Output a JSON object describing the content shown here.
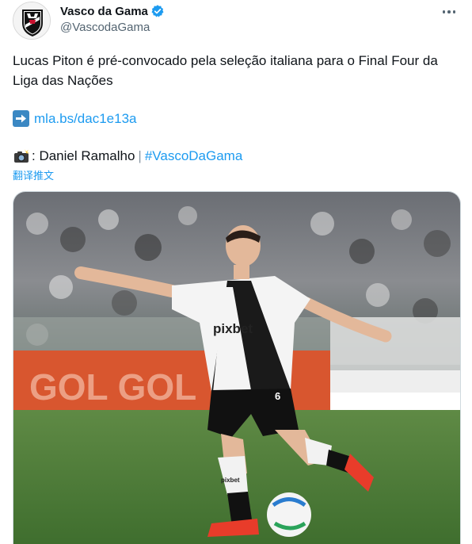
{
  "author": {
    "display_name": "Vasco da Gama",
    "handle": "@VascodaGama",
    "verified_icon": "verified-badge-icon",
    "avatar_icon": "vasco-crest-logo"
  },
  "menu": {
    "more_icon": "more-options-icon"
  },
  "tweet": {
    "text_lines": [
      "Lucas Piton é pré-convocado pela seleção italiana para o Final Four da Liga das Nações"
    ],
    "link_icon": "right-arrow-emoji-icon",
    "link_text": "mla.bs/dac1e13a",
    "credit_icon": "camera-flash-emoji-icon",
    "credit_prefix": ": Daniel Ramalho",
    "credit_separator": "|",
    "hashtag": "#VascoDaGama",
    "translate_label": "翻译推文"
  },
  "media": {
    "description": "photo",
    "jersey_sponsor": "pixbet",
    "jersey_number": "6",
    "sock_text": "pixbet",
    "banner_text": "GOL GOL"
  },
  "colors": {
    "link": "#1d9bf0",
    "text": "#0f1419",
    "secondary": "#536471"
  }
}
